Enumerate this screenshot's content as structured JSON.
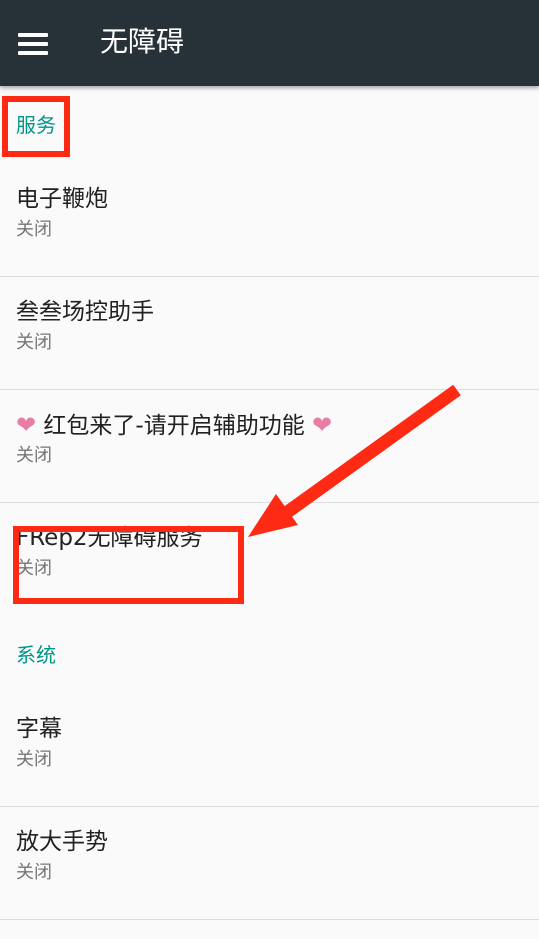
{
  "appbar": {
    "title": "无障碍",
    "menu_icon": "hamburger-menu-icon",
    "background": "#263238"
  },
  "sections": [
    {
      "header": "服务",
      "items": [
        {
          "title": "电子鞭炮",
          "summary": "关闭"
        },
        {
          "title": "叁叁场控助手",
          "summary": "关闭"
        },
        {
          "title_prefix_icon": "heart-icon",
          "title": "红包来了-请开启辅助功能",
          "title_suffix_icon": "heart-icon",
          "summary": "关闭"
        },
        {
          "title": "FRep2无障碍服务",
          "summary": "关闭"
        }
      ]
    },
    {
      "header": "系统",
      "items": [
        {
          "title": "字幕",
          "summary": "关闭"
        },
        {
          "title": "放大手势",
          "summary": "关闭"
        }
      ]
    }
  ],
  "colors": {
    "accent": "#009688",
    "annotation_red": "#ff2a14",
    "heart_pink": "#e87ea6"
  }
}
